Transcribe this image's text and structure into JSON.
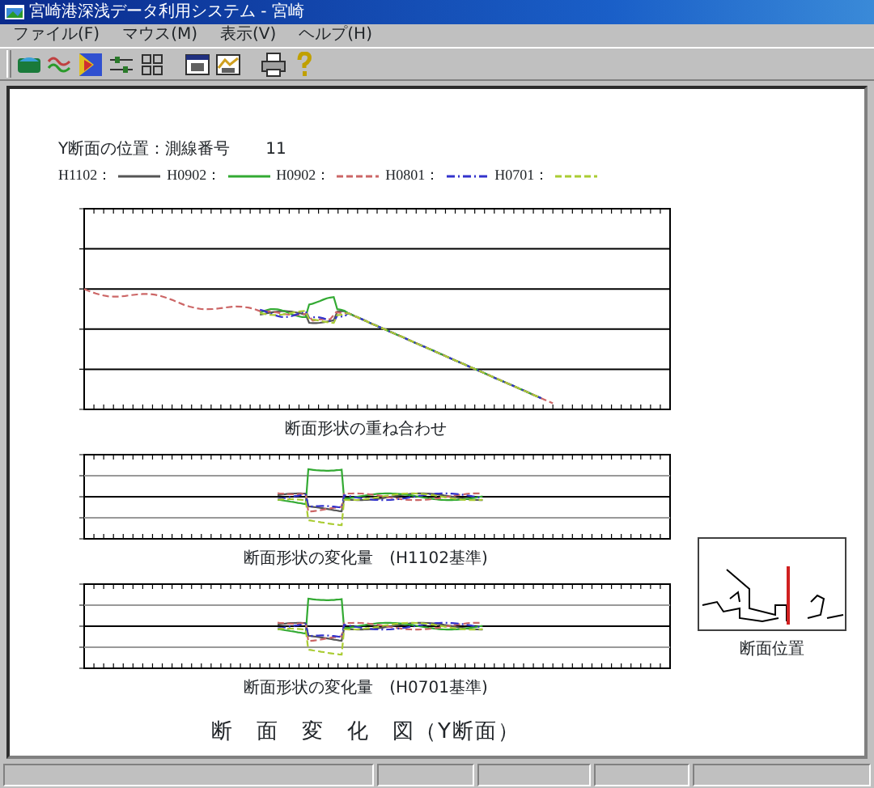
{
  "window": {
    "title": "宮崎港深浅データ利用システム - 宮崎"
  },
  "menu": [
    "ファイル(F)",
    "マウス(M)",
    "表示(V)",
    "ヘルプ(H)"
  ],
  "header": {
    "label": "Y断面の位置：測線番号",
    "value": "11"
  },
  "legend": [
    {
      "label": "H1102：",
      "color": "#555555",
      "kind": "solid"
    },
    {
      "label": "H0902：",
      "color": "#33aa33",
      "kind": "solid"
    },
    {
      "label": "H0902：",
      "color": "#cc6666",
      "kind": "dashed"
    },
    {
      "label": "H0801：",
      "color": "#3333cc",
      "kind": "dashdot"
    },
    {
      "label": "H0701：",
      "color": "#aacc33",
      "kind": "dashed"
    }
  ],
  "charts": [
    {
      "kind": "overlay",
      "caption": "断面形状の重ね合わせ"
    },
    {
      "kind": "change",
      "caption": "断面形状の変化量　(H1102基準)"
    },
    {
      "kind": "change",
      "caption": "断面形状の変化量　(H0701基準)"
    }
  ],
  "main_title": "断　面　変　化　図（Y断面）",
  "location_map": {
    "caption": "断面位置"
  }
}
